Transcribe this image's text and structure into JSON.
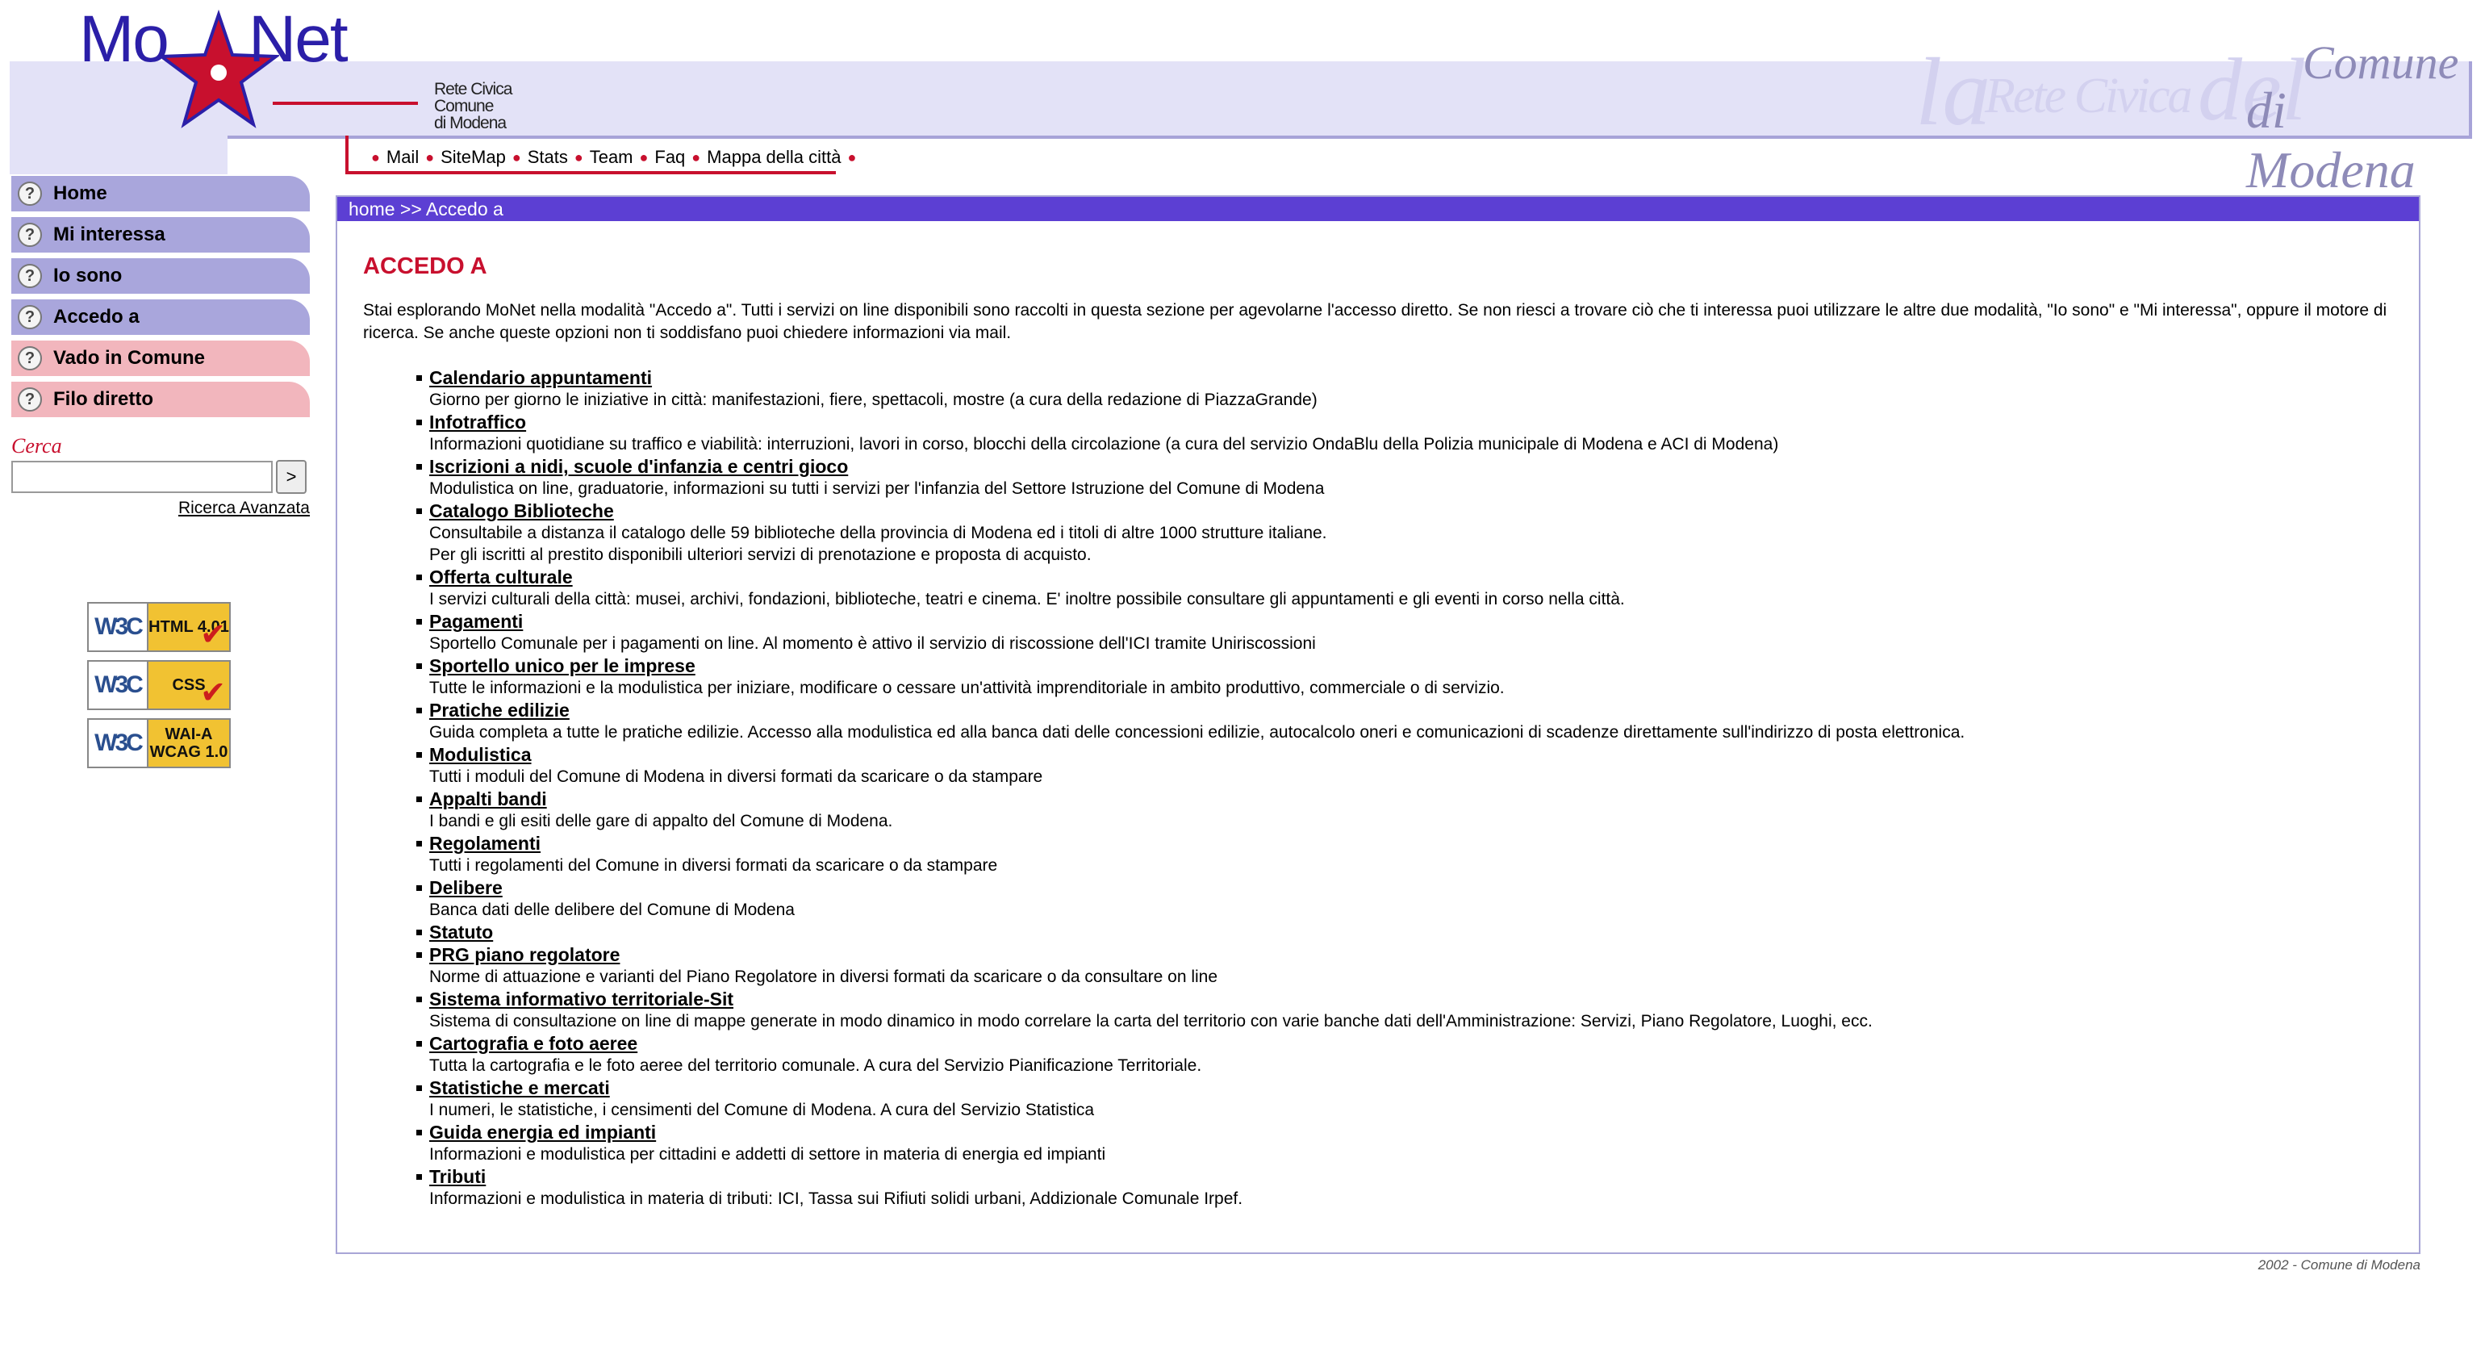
{
  "logo": {
    "mo": "Mo",
    "net": "Net",
    "subtitle": [
      "Rete Civica",
      "Comune",
      "di Modena"
    ]
  },
  "header_title": {
    "la": "la",
    "rete_civica": "Rete Civica",
    "del": "del",
    "comune": "Comune",
    "di_modena": "di Modena"
  },
  "top_menu": [
    "Mail",
    "SiteMap",
    "Stats",
    "Team",
    "Faq",
    "Mappa della città"
  ],
  "sidebar": {
    "items": [
      {
        "label": "Home",
        "color": "#a9a6dc"
      },
      {
        "label": "Mi interessa",
        "color": "#a9a6dc"
      },
      {
        "label": "Io sono",
        "color": "#a9a6dc"
      },
      {
        "label": "Accedo a",
        "color": "#a9a6dc"
      },
      {
        "label": "Vado in Comune",
        "color": "#f2b6bd"
      },
      {
        "label": "Filo diretto",
        "color": "#f2b6bd"
      }
    ],
    "search_label": "Cerca",
    "search_button": ">",
    "advanced_search": "Ricerca Avanzata",
    "badges": [
      {
        "w3c": "W3C",
        "label": "HTML 4.01"
      },
      {
        "w3c": "W3C",
        "label": "CSS"
      },
      {
        "w3c": "W3C",
        "label": "WAI-A WCAG 1.0"
      }
    ]
  },
  "breadcrumb": "home >> Accedo a",
  "page_title": "ACCEDO A",
  "intro": "Stai esplorando MoNet nella modalità \"Accedo a\". Tutti i servizi on line disponibili sono raccolti in questa sezione per agevolarne l'accesso diretto. Se non riesci a trovare ciò che ti interessa puoi utilizzare le altre due modalità, \"Io sono\" e \"Mi interessa\", oppure il motore di ricerca. Se anche queste opzioni non ti soddisfano puoi chiedere informazioni via mail.",
  "services": [
    {
      "title": "Calendario appuntamenti",
      "desc": "Giorno per giorno le iniziative in città: manifestazioni, fiere, spettacoli, mostre (a cura della redazione di PiazzaGrande)"
    },
    {
      "title": "Infotraffico",
      "desc": "Informazioni quotidiane su traffico e viabilità: interruzioni, lavori in corso, blocchi della circolazione (a cura del servizio OndaBlu della Polizia municipale di Modena e ACI di Modena)"
    },
    {
      "title": "Iscrizioni a nidi, scuole d'infanzia e centri gioco",
      "desc": "Modulistica on line, graduatorie, informazioni su tutti i servizi per l'infanzia del Settore Istruzione del Comune di Modena"
    },
    {
      "title": "Catalogo Biblioteche",
      "desc": "Consultabile a distanza il catalogo delle 59 biblioteche della provincia di Modena ed i titoli di altre 1000 strutture italiane.\nPer gli iscritti al prestito disponibili ulteriori servizi di prenotazione e proposta di acquisto."
    },
    {
      "title": "Offerta culturale",
      "desc": "I servizi culturali della città: musei, archivi, fondazioni, biblioteche, teatri e cinema. E' inoltre possibile consultare gli appuntamenti e gli eventi in corso nella città."
    },
    {
      "title": "Pagamenti",
      "desc": "Sportello Comunale per i pagamenti on line. Al momento è attivo il servizio di riscossione dell'ICI tramite Uniriscossioni"
    },
    {
      "title": "Sportello unico per le imprese",
      "desc": "Tutte le informazioni e la modulistica per iniziare, modificare o cessare un'attività imprenditoriale in ambito produttivo, commerciale o di servizio."
    },
    {
      "title": "Pratiche edilizie",
      "desc": "Guida completa a tutte le pratiche edilizie. Accesso alla modulistica ed alla banca dati delle concessioni edilizie, autocalcolo oneri e comunicazioni di scadenze direttamente sull'indirizzo di posta elettronica."
    },
    {
      "title": "Modulistica",
      "desc": "Tutti i moduli del Comune di Modena in diversi formati da scaricare o da stampare"
    },
    {
      "title": "Appalti bandi",
      "desc": "I bandi e gli esiti delle gare di appalto del Comune di Modena."
    },
    {
      "title": "Regolamenti",
      "desc": "Tutti i regolamenti del Comune in diversi formati da scaricare o da stampare"
    },
    {
      "title": "Delibere",
      "desc": "Banca dati delle delibere del Comune di Modena"
    },
    {
      "title": "Statuto",
      "desc": ""
    },
    {
      "title": "PRG piano regolatore",
      "desc": "Norme di attuazione e varianti del Piano Regolatore in diversi formati da scaricare o da consultare on line"
    },
    {
      "title": "Sistema informativo territoriale-Sit",
      "desc": "Sistema di consultazione on line di mappe generate in modo dinamico in modo correlare la carta del territorio con varie banche dati dell'Amministrazione: Servizi, Piano Regolatore, Luoghi, ecc."
    },
    {
      "title": "Cartografia e foto aeree",
      "desc": "Tutta la cartografia e le foto aeree del territorio comunale. A cura del Servizio Pianificazione Territoriale."
    },
    {
      "title": "Statistiche e mercati",
      "desc": "I numeri, le statistiche, i censimenti del Comune di Modena. A cura del Servizio Statistica"
    },
    {
      "title": "Guida energia ed impianti",
      "desc": "Informazioni e modulistica per cittadini e addetti di settore in materia di energia ed impianti"
    },
    {
      "title": "Tributi",
      "desc": "Informazioni e modulistica in materia di tributi: ICI, Tassa sui Rifiuti solidi urbani, Addizionale Comunale Irpef."
    }
  ],
  "footer": "2002 - Comune di Modena",
  "colors": {
    "accent_red": "#c8102e",
    "header_lavender": "#e3e2f7",
    "nav_violet": "#a9a6dc",
    "nav_pink": "#f2b6bd",
    "breadcrumb_bg": "#5c3fd3"
  }
}
